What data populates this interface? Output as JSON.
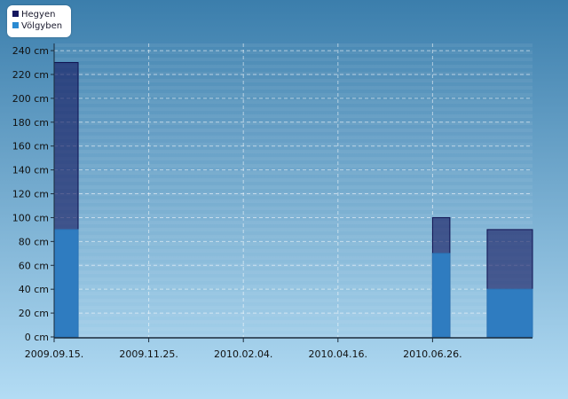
{
  "chart_data": {
    "type": "bar",
    "title": "",
    "xlabel": "",
    "ylabel": "",
    "y_unit": "cm",
    "ylim": [
      0,
      246
    ],
    "y_ticks": [
      "0 cm",
      "20 cm",
      "40 cm",
      "60 cm",
      "80 cm",
      "100 cm",
      "120 cm",
      "140 cm",
      "160 cm",
      "180 cm",
      "200 cm",
      "220 cm",
      "240 cm"
    ],
    "x_ticks": [
      "2009.09.15.",
      "2009.11.25.",
      "2010.02.04.",
      "2010.04.16.",
      "2010.06.26."
    ],
    "x_range": [
      "2009.09.15.",
      "2010.09.09."
    ],
    "grid": true,
    "legend_placement": "top-left",
    "series": [
      {
        "name": "Hegyen",
        "color": "#14165e",
        "bars": [
          {
            "start": "2009.09.15.",
            "end": "2009.10.03.",
            "value": 230
          },
          {
            "start": "2010.06.26.",
            "end": "2010.07.09.",
            "value": 100
          },
          {
            "start": "2010.08.06.",
            "end": "2010.09.09.",
            "value": 90
          }
        ]
      },
      {
        "name": "Völgyben",
        "color": "#2a8ad2",
        "bars": [
          {
            "start": "2009.09.15.",
            "end": "2009.10.03.",
            "value": 90
          },
          {
            "start": "2010.06.26.",
            "end": "2010.07.09.",
            "value": 70
          },
          {
            "start": "2010.08.06.",
            "end": "2010.09.09.",
            "value": 40
          }
        ]
      }
    ]
  }
}
